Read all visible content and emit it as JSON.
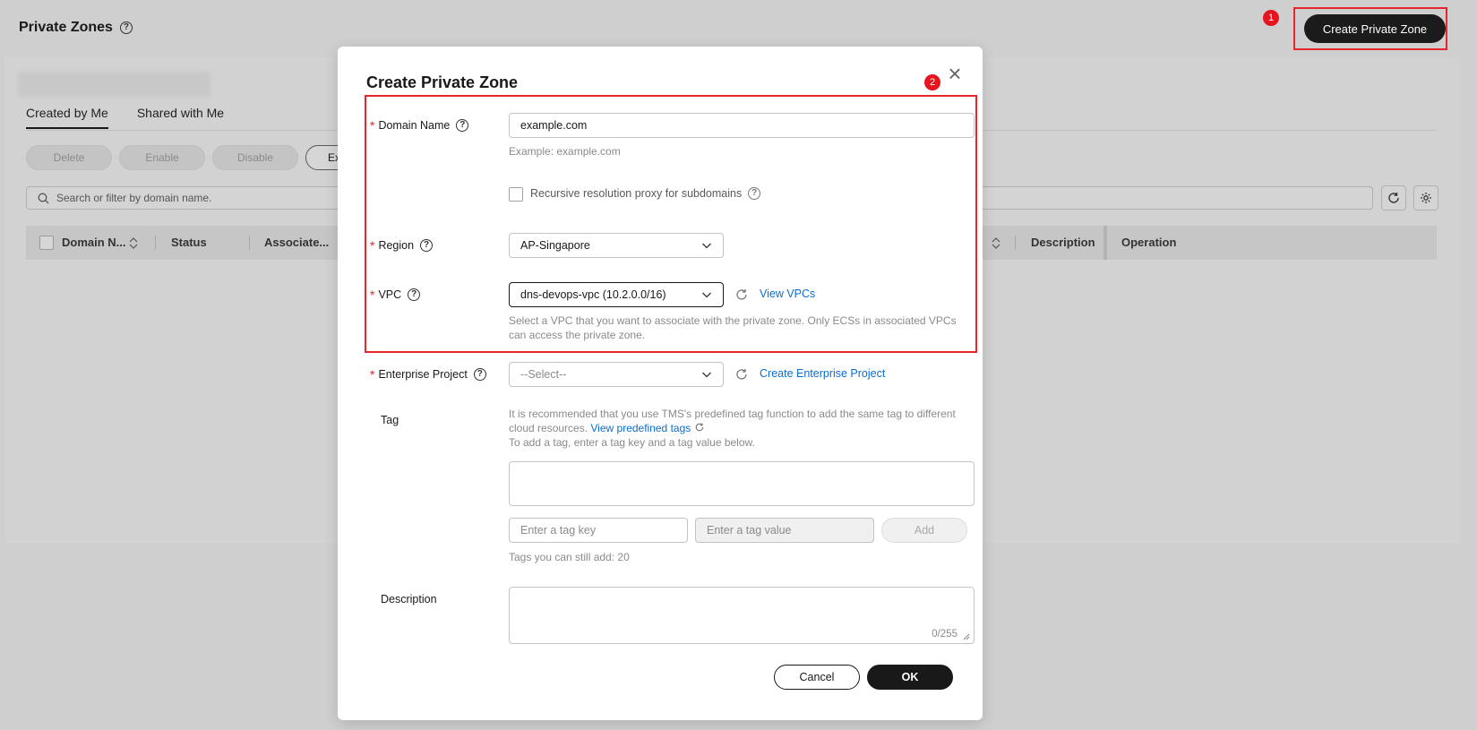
{
  "page": {
    "title": "Private Zones",
    "create_button": "Create Private Zone",
    "tabs": [
      {
        "label": "Created by Me",
        "active": true
      },
      {
        "label": "Shared with Me",
        "active": false
      }
    ],
    "actions": {
      "delete": "Delete",
      "enable": "Enable",
      "disable": "Disable",
      "export": "Ex"
    },
    "search_placeholder": "Search or filter by domain name.",
    "columns": {
      "domain_name": "Domain N...",
      "status": "Status",
      "associated": "Associate...",
      "description": "Description",
      "operation": "Operation"
    }
  },
  "annotations": {
    "badge1": "1",
    "badge2": "2"
  },
  "modal": {
    "title": "Create Private Zone",
    "close_glyph": "×",
    "domain_name": {
      "label": "Domain Name",
      "value": "example.com",
      "hint": "Example: example.com",
      "recursive_label": "Recursive resolution proxy for subdomains"
    },
    "region": {
      "label": "Region",
      "value": "AP-Singapore"
    },
    "vpc": {
      "label": "VPC",
      "value": "dns-devops-vpc (10.2.0.0/16)",
      "link": "View VPCs",
      "hint_line1": "Select a VPC that you want to associate with the private zone. Only ECSs in associated VPCs",
      "hint_line2": "can access the private zone."
    },
    "enterprise_project": {
      "label": "Enterprise Project",
      "value": "--Select--",
      "link": "Create Enterprise Project"
    },
    "tag": {
      "label": "Tag",
      "info_line1": "It is recommended that you use TMS's predefined tag function to add the same tag to different",
      "info_line2_prefix": "cloud resources.",
      "info_link": "View predefined tags",
      "info_line3": "To add a tag, enter a tag key and a tag value below.",
      "key_placeholder": "Enter a tag key",
      "value_placeholder": "Enter a tag value",
      "add_button": "Add",
      "remaining": "Tags you can still add: 20"
    },
    "description": {
      "label": "Description",
      "counter": "0/255"
    },
    "cancel_button": "Cancel",
    "ok_button": "OK"
  },
  "colors": {
    "highlight": "#e5262a",
    "link": "#0a6ed1",
    "primary_button": "#191919"
  }
}
